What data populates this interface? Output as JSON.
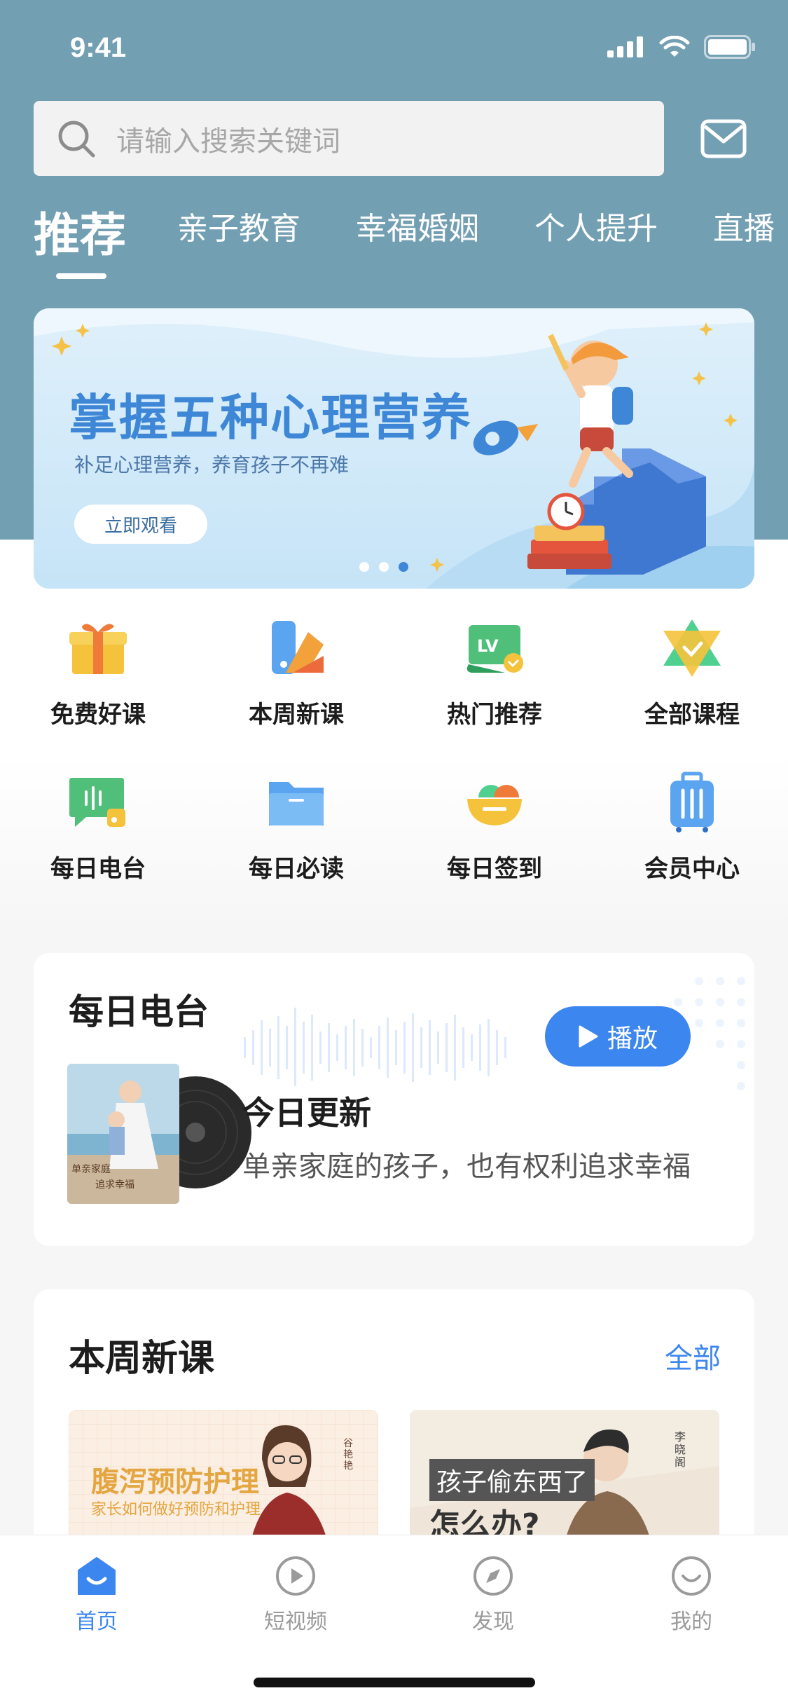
{
  "status_bar": {
    "time": "9:41"
  },
  "search": {
    "placeholder": "请输入搜索关键词"
  },
  "tabs": [
    {
      "label": "推荐",
      "active": true
    },
    {
      "label": "亲子教育"
    },
    {
      "label": "幸福婚姻"
    },
    {
      "label": "个人提升"
    },
    {
      "label": "直播"
    }
  ],
  "banner": {
    "title": "掌握五种心理营养",
    "subtitle": "补足心理营养，养育孩子不再难",
    "button": "立即观看",
    "active_dot": 3,
    "dot_count": 3
  },
  "grid": [
    {
      "label": "免费好课",
      "icon": "gift-icon"
    },
    {
      "label": "本周新课",
      "icon": "palette-icon"
    },
    {
      "label": "热门推荐",
      "icon": "level-badge-icon"
    },
    {
      "label": "全部课程",
      "icon": "star-check-icon"
    },
    {
      "label": "每日电台",
      "icon": "radio-chat-icon"
    },
    {
      "label": "每日必读",
      "icon": "folder-icon"
    },
    {
      "label": "每日签到",
      "icon": "bowl-icon"
    },
    {
      "label": "会员中心",
      "icon": "suitcase-icon"
    }
  ],
  "radio": {
    "title": "每日电台",
    "play_label": "播放",
    "update_title": "今日更新",
    "update_desc": "单亲家庭的孩子，也有权利追求幸福",
    "album_text_1": "单亲家庭",
    "album_text_2": "追求幸福"
  },
  "new_courses": {
    "title": "本周新课",
    "more": "全部",
    "items": [
      {
        "title": "腹泻预防护理",
        "subtitle": "家长如何做好预防和护理",
        "side_name": "谷艳艳"
      },
      {
        "tag": "孩子偷东西了",
        "title": "怎么办?",
        "side_name": "李晓阁"
      }
    ]
  },
  "tabbar": [
    {
      "label": "首页",
      "icon": "home-icon",
      "active": true
    },
    {
      "label": "短视频",
      "icon": "play-circle-icon"
    },
    {
      "label": "发现",
      "icon": "compass-icon"
    },
    {
      "label": "我的",
      "icon": "smile-icon"
    }
  ],
  "colors": {
    "header": "#739fb3",
    "accent": "#3c86ef"
  }
}
